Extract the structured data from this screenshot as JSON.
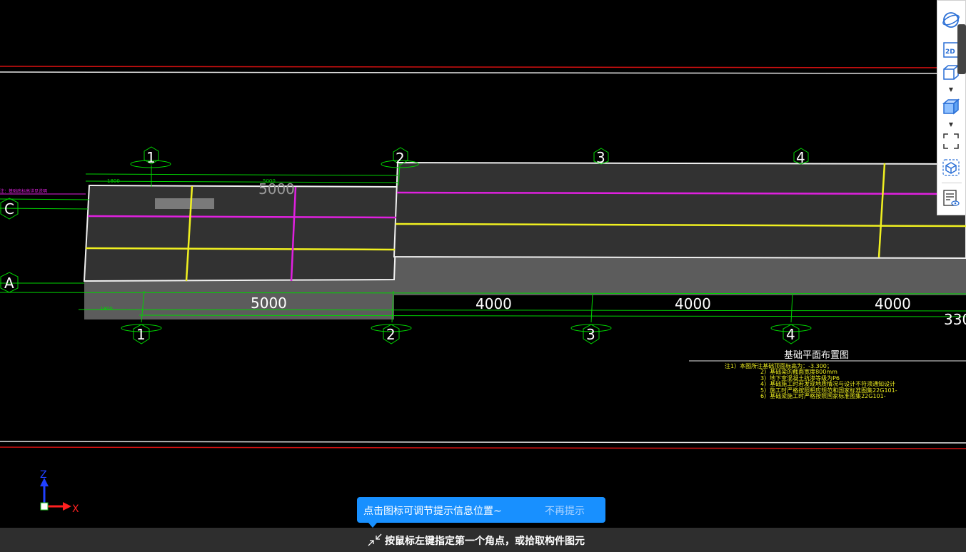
{
  "drawing": {
    "axis_labels_top": [
      "1",
      "2",
      "3",
      "4"
    ],
    "axis_labels_bottom": [
      "1",
      "2",
      "3",
      "4"
    ],
    "row_labels": [
      "C",
      "A"
    ],
    "dimensions": [
      "5000",
      "4000",
      "4000",
      "4000",
      "330"
    ],
    "faint_dim_top": "5000",
    "small_dims": [
      "1800",
      "5000",
      "1800"
    ],
    "title_block": {
      "title": "基础平面布置图",
      "notes": [
        "注1）本图所注基础顶面标高为：-3.300；",
        "2）基础梁的截面宽度800mm",
        "3）地下室混凝土抗渗等级为P6",
        "4）基础施工时若发现地质情况与设计不符须通知设计",
        "5）施工时严格按照相应规范和国家标准图集22G101-",
        "6）基础梁施工时严格按照国家标准图集22G101-"
      ]
    },
    "left_note": "注：基础底标高详见说明",
    "ucs": {
      "z": "Z",
      "x": "X"
    }
  },
  "toolbar": {
    "buttons": [
      "orbit-icon",
      "view-2d-icon",
      "view-3d-wire-icon",
      "view-3d-solid-icon",
      "fullscreen-icon",
      "component-view-icon",
      "display-settings-icon"
    ],
    "view2d_label": "2D"
  },
  "tip": {
    "text": "点击图标可调节提示信息位置~",
    "dismiss": "不再提示"
  },
  "status": {
    "prompt": "按鼠标左键指定第一个角点，或拾取构件图元"
  },
  "colors": {
    "background": "#000000",
    "grid_green": "#00d400",
    "beam_magenta": "#e020e0",
    "beam_yellow": "#f0f020",
    "slab_dark": "#323232",
    "slab_side": "#5c5c5c",
    "boundary_red": "#d01010",
    "tip_blue": "#1890ff",
    "status_bg": "#2e2e2e"
  }
}
